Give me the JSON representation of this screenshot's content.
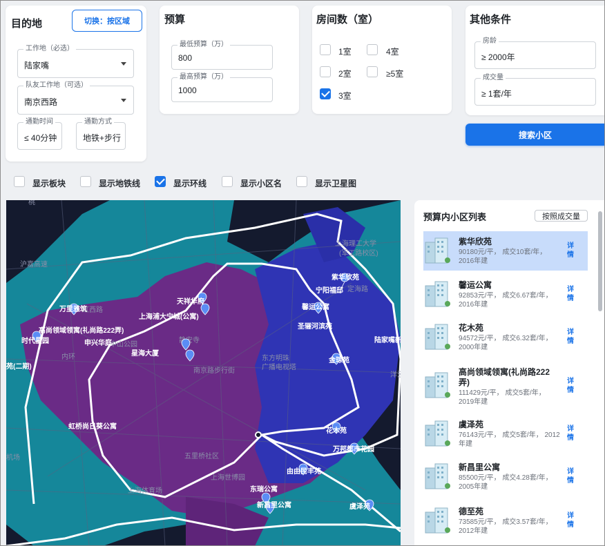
{
  "destination": {
    "title": "目的地",
    "switch_label": "切换：按区域",
    "workplace": {
      "label": "工作地（必选）",
      "value": "陆家嘴"
    },
    "partner_workplace": {
      "label": "队友工作地（可选）",
      "value": "南京西路"
    },
    "commute_time": {
      "label": "通勤时间",
      "value": "≤ 40分钟"
    },
    "commute_mode": {
      "label": "通勤方式",
      "value": "地铁+步行"
    }
  },
  "budget": {
    "title": "预算",
    "min": {
      "label": "最低预算（万）",
      "value": "800"
    },
    "max": {
      "label": "最高预算（万）",
      "value": "1000"
    }
  },
  "rooms": {
    "title": "房间数（室）",
    "options": [
      {
        "label": "1室",
        "checked": false
      },
      {
        "label": "4室",
        "checked": false
      },
      {
        "label": "2室",
        "checked": false
      },
      {
        "label": "≥5室",
        "checked": false
      },
      {
        "label": "3室",
        "checked": true
      }
    ]
  },
  "other": {
    "title": "其他条件",
    "age": {
      "label": "房龄",
      "value": "≥ 2000年"
    },
    "volume": {
      "label": "成交量",
      "value": "≥ 1套/年"
    },
    "search_label": "搜索小区"
  },
  "layers": [
    {
      "label": "显示板块",
      "checked": false
    },
    {
      "label": "显示地铁线",
      "checked": false
    },
    {
      "label": "显示环线",
      "checked": true
    },
    {
      "label": "显示小区名",
      "checked": false
    },
    {
      "label": "显示卫星图",
      "checked": false
    }
  ],
  "map": {
    "colors": {
      "background": "#141a2e",
      "teal": "#1a8fa0",
      "purple": "#6e2a8a",
      "blue": "#2e35b8",
      "ring": "#ffffff"
    },
    "markers": [
      {
        "name": "紫华欣苑"
      },
      {
        "name": "宁阳福邸"
      },
      {
        "name": "馨运公寓"
      },
      {
        "name": "圣骊河滨苑"
      },
      {
        "name": "金琮苑"
      },
      {
        "name": "陆家嘴新"
      },
      {
        "name": "天祥华府"
      },
      {
        "name": "上海浦大宁城(公寓)"
      },
      {
        "name": "万里雅筑"
      },
      {
        "name": "高尚领域领寓(礼尚路222弄)"
      },
      {
        "name": "时代星园"
      },
      {
        "name": "申兴华庭"
      },
      {
        "name": "星海大厦"
      },
      {
        "name": "苑(二期)"
      },
      {
        "name": "虹桥尚日葵公寓"
      },
      {
        "name": "花木苑"
      },
      {
        "name": "万邦都市花园"
      },
      {
        "name": "由由民丰苑"
      },
      {
        "name": "东瑞公寓"
      },
      {
        "name": "新昌里公寓"
      },
      {
        "name": "虞泽苑"
      }
    ],
    "base_labels": [
      {
        "text": "上海理工大学"
      },
      {
        "text": "(军工路校区)"
      },
      {
        "text": "沪嘉高速"
      },
      {
        "text": "定海路"
      },
      {
        "text": "东方明珠"
      },
      {
        "text": "广播电视塔"
      },
      {
        "text": "南京路步行街"
      },
      {
        "text": "五里桥社区"
      },
      {
        "text": "上海世博园"
      },
      {
        "text": "机场"
      },
      {
        "text": "上海体育场"
      },
      {
        "text": "洋泾"
      },
      {
        "text": "桃"
      },
      {
        "text": "虹西路"
      },
      {
        "text": "中山公园"
      },
      {
        "text": "静安寺"
      },
      {
        "text": "内环"
      }
    ]
  },
  "list": {
    "title": "预算内小区列表",
    "sort_label": "按照成交量",
    "detail_label": "详情",
    "items": [
      {
        "name": "紫华欣苑",
        "meta": "90180元/平， 成交10套/年， 2016年建",
        "selected": true
      },
      {
        "name": "馨运公寓",
        "meta": "92853元/平， 成交6.67套/年， 2016年建",
        "selected": false
      },
      {
        "name": "花木苑",
        "meta": "94572元/平， 成交6.32套/年， 2000年建",
        "selected": false
      },
      {
        "name": "高尚领域领寓(礼尚路222弄)",
        "meta": "111429元/平， 成交5套/年， 2019年建",
        "selected": false
      },
      {
        "name": "虞泽苑",
        "meta": "76143元/平， 成交5套/年， 2012年建",
        "selected": false
      },
      {
        "name": "新昌里公寓",
        "meta": "85500元/平， 成交4.28套/年， 2005年建",
        "selected": false
      },
      {
        "name": "德至苑",
        "meta": "73585元/平， 成交3.57套/年， 2012年建",
        "selected": false
      }
    ]
  }
}
